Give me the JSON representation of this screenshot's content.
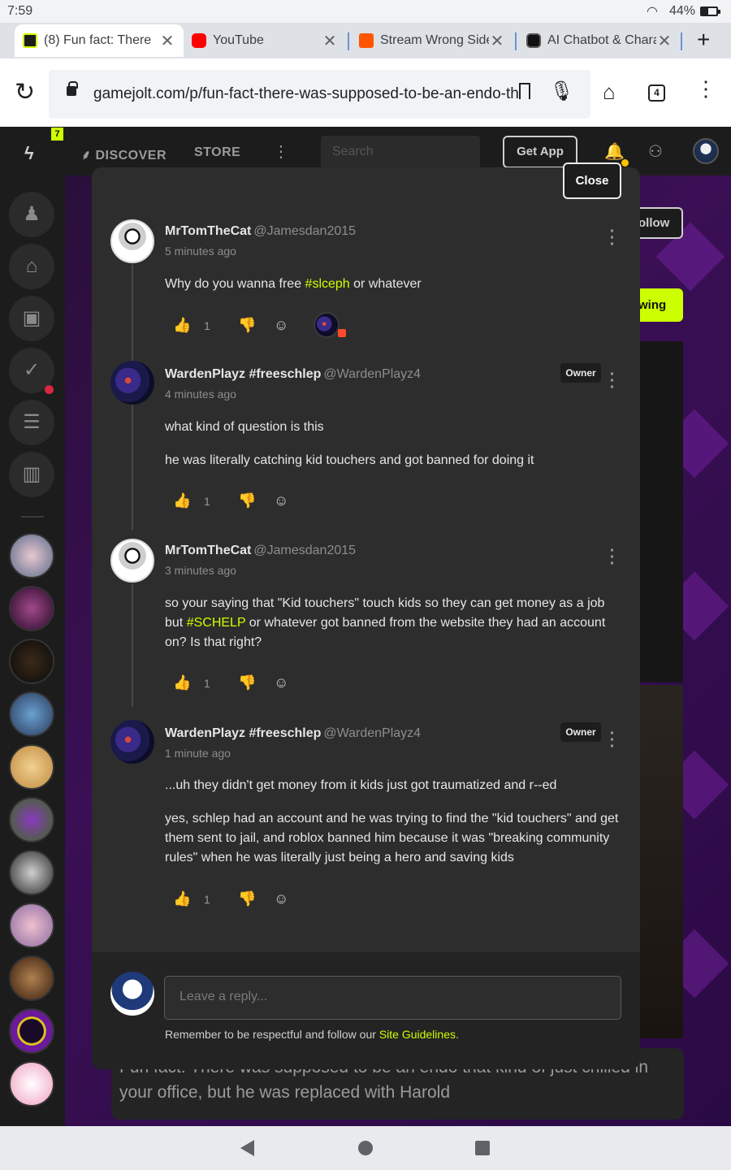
{
  "status_bar": {
    "time": "7:59",
    "battery": "44%"
  },
  "browser": {
    "tabs": [
      {
        "title": "(8) Fun fact: There",
        "favicon": "gamejolt-icon",
        "active": true
      },
      {
        "title": "YouTube",
        "favicon": "youtube-icon",
        "active": false
      },
      {
        "title": "Stream Wrong Side",
        "favicon": "soundcloud-icon",
        "active": false
      },
      {
        "title": "AI Chatbot & Chara",
        "favicon": "character-ai-icon",
        "active": false
      }
    ],
    "url": "gamejolt.com/p/fun-fact-there-was-supposed-to-be-an-endo-th",
    "tab_count": "4"
  },
  "site_header": {
    "notification_badge": "7",
    "nav": [
      "DISCOVER",
      "STORE"
    ],
    "search_placeholder": "Search",
    "get_app_label": "Get App"
  },
  "background_page": {
    "follow_label": "ollow",
    "following_label": "wing",
    "post_text": "Fun fact: There was supposed to be an endo that kind of just chilled in your office, but he was replaced with Harold"
  },
  "modal": {
    "close_label": "Close",
    "comments": [
      {
        "username": "MrTomTheCat",
        "handle": "@Jamesdan2015",
        "time_ago": "5 minutes ago",
        "owner": false,
        "paragraphs": [
          [
            {
              "t": "Why do you wanna free "
            },
            {
              "t": "#slceph",
              "tag": true
            },
            {
              "t": " or whatever"
            }
          ]
        ],
        "likes": "1"
      },
      {
        "username": "WardenPlayz #freeschlep",
        "handle": "@WardenPlayz4",
        "time_ago": "4 minutes ago",
        "owner": true,
        "paragraphs": [
          [
            {
              "t": "what kind of question is this"
            }
          ],
          [
            {
              "t": "he was literally catching kid touchers and got banned for doing it"
            }
          ]
        ],
        "likes": "1"
      },
      {
        "username": "MrTomTheCat",
        "handle": "@Jamesdan2015",
        "time_ago": "3 minutes ago",
        "owner": false,
        "paragraphs": [
          [
            {
              "t": "so your saying that \"Kid touchers\" touch kids so they can get money as a job but "
            },
            {
              "t": "#SCHELP",
              "tag": true
            },
            {
              "t": " or whatever got banned from the website they had an account on? Is that right?"
            }
          ]
        ],
        "likes": "1"
      },
      {
        "username": "WardenPlayz #freeschlep",
        "handle": "@WardenPlayz4",
        "time_ago": "1 minute ago",
        "owner": true,
        "paragraphs": [
          [
            {
              "t": "...uh they didn't get money from it kids just got traumatized and r--ed"
            }
          ],
          [
            {
              "t": "yes, schlep had an account and he was trying to find the \"kid touchers\" and get them sent to jail, and roblox banned him because it was \"breaking community rules\" when he was literally just being a hero and saving kids"
            }
          ]
        ],
        "likes": "1"
      }
    ],
    "owner_label": "Owner",
    "reply_placeholder": "Leave a reply...",
    "reply_note": "Remember to be respectful and follow our ",
    "reply_note_link": "Site Guidelines",
    "reply_note_end": "."
  },
  "colors": {
    "accent": "#ccff00",
    "modal_bg": "#2d2d2d",
    "page_bg": "#1c1c1c"
  }
}
